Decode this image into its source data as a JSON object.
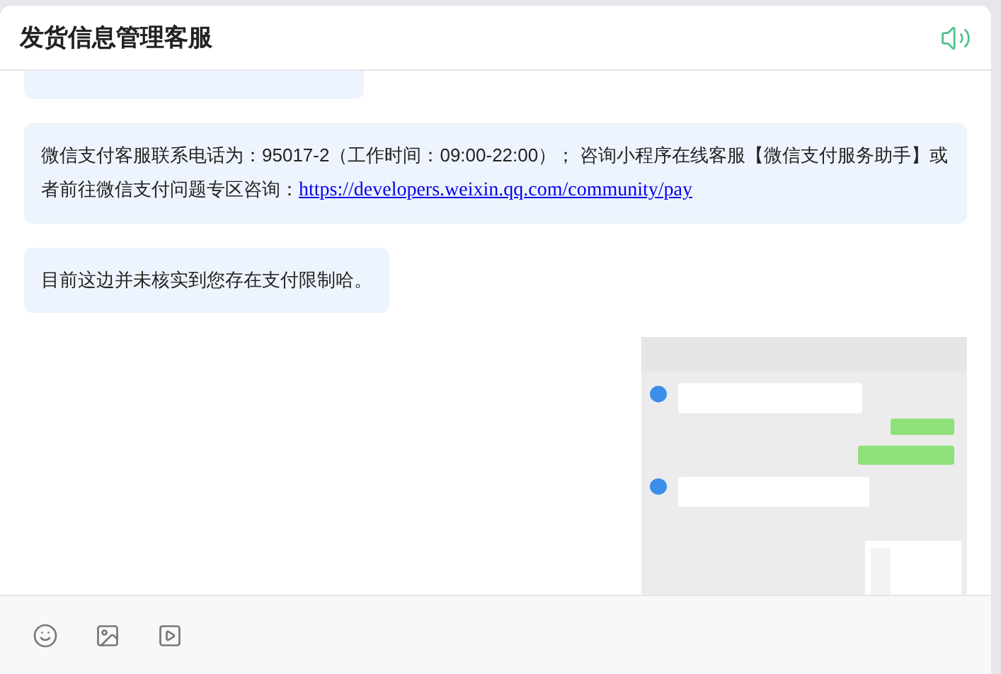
{
  "header": {
    "title": "发货信息管理客服"
  },
  "messages": [
    {
      "kind": "hidden_text"
    },
    {
      "kind": "text",
      "text": "微信支付客服联系电话为：95017-2（工作时间：09:00-22:00）； 咨询小程序在线客服【微信支付服务助手】或者前往微信支付问题专区咨询：",
      "link": "https://developers.weixin.qq.com/community/pay"
    },
    {
      "kind": "text",
      "text": "目前这边并未核实到您存在支付限制哈。"
    },
    {
      "kind": "picture"
    }
  ]
}
